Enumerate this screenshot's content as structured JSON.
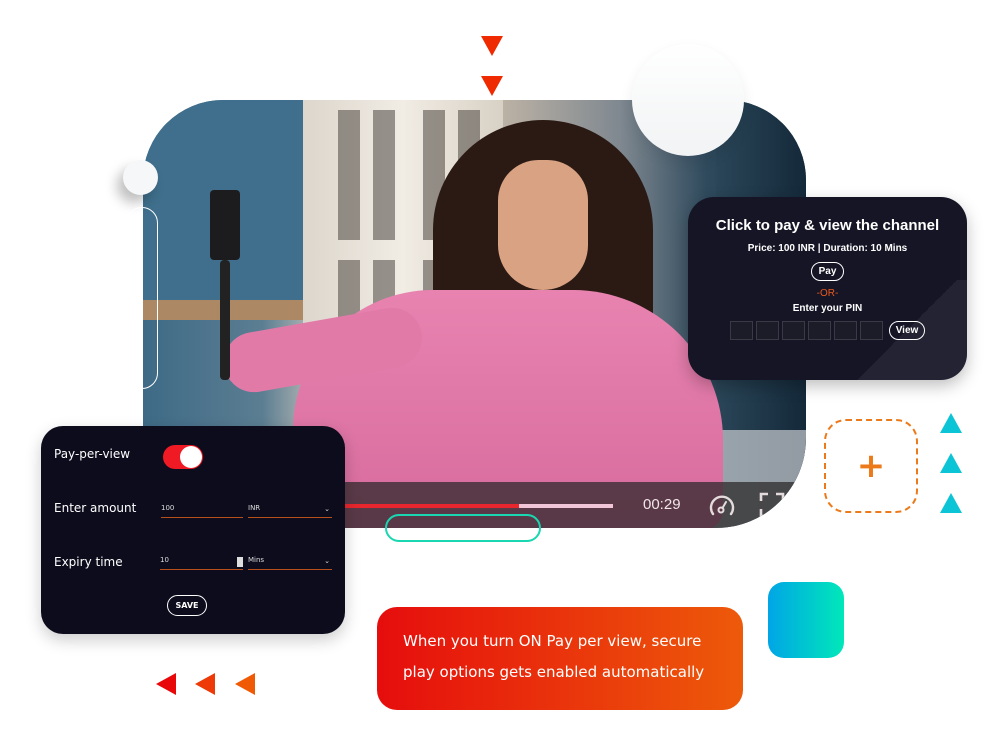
{
  "video": {
    "current_time": "00:29",
    "progress_played": 0.65,
    "progress_buffered": 1.0
  },
  "pay_card": {
    "title": "Click to pay & view the channel",
    "price_line": "Price: 100 INR | Duration: 10 Mins",
    "pay_button": "Pay",
    "or_text": "-OR-",
    "pin_label": "Enter your PIN",
    "pin_length": 6,
    "view_button": "View"
  },
  "settings": {
    "ppv_label": "Pay-per-view",
    "ppv_enabled": true,
    "amount_label": "Enter amount",
    "amount_value": "100",
    "currency_value": "INR",
    "expiry_label": "Expiry time",
    "expiry_value": "10",
    "expiry_unit": "Mins",
    "save_button": "SAVE"
  },
  "banner": {
    "line1": "When you turn ON Pay per view, secure",
    "line2": "play options gets enabled automatically"
  },
  "decor": {
    "plus_symbol": "+",
    "accent_red": "#f02a00",
    "accent_orange": "#ec7a1b",
    "accent_teal": "#19d7b0"
  }
}
